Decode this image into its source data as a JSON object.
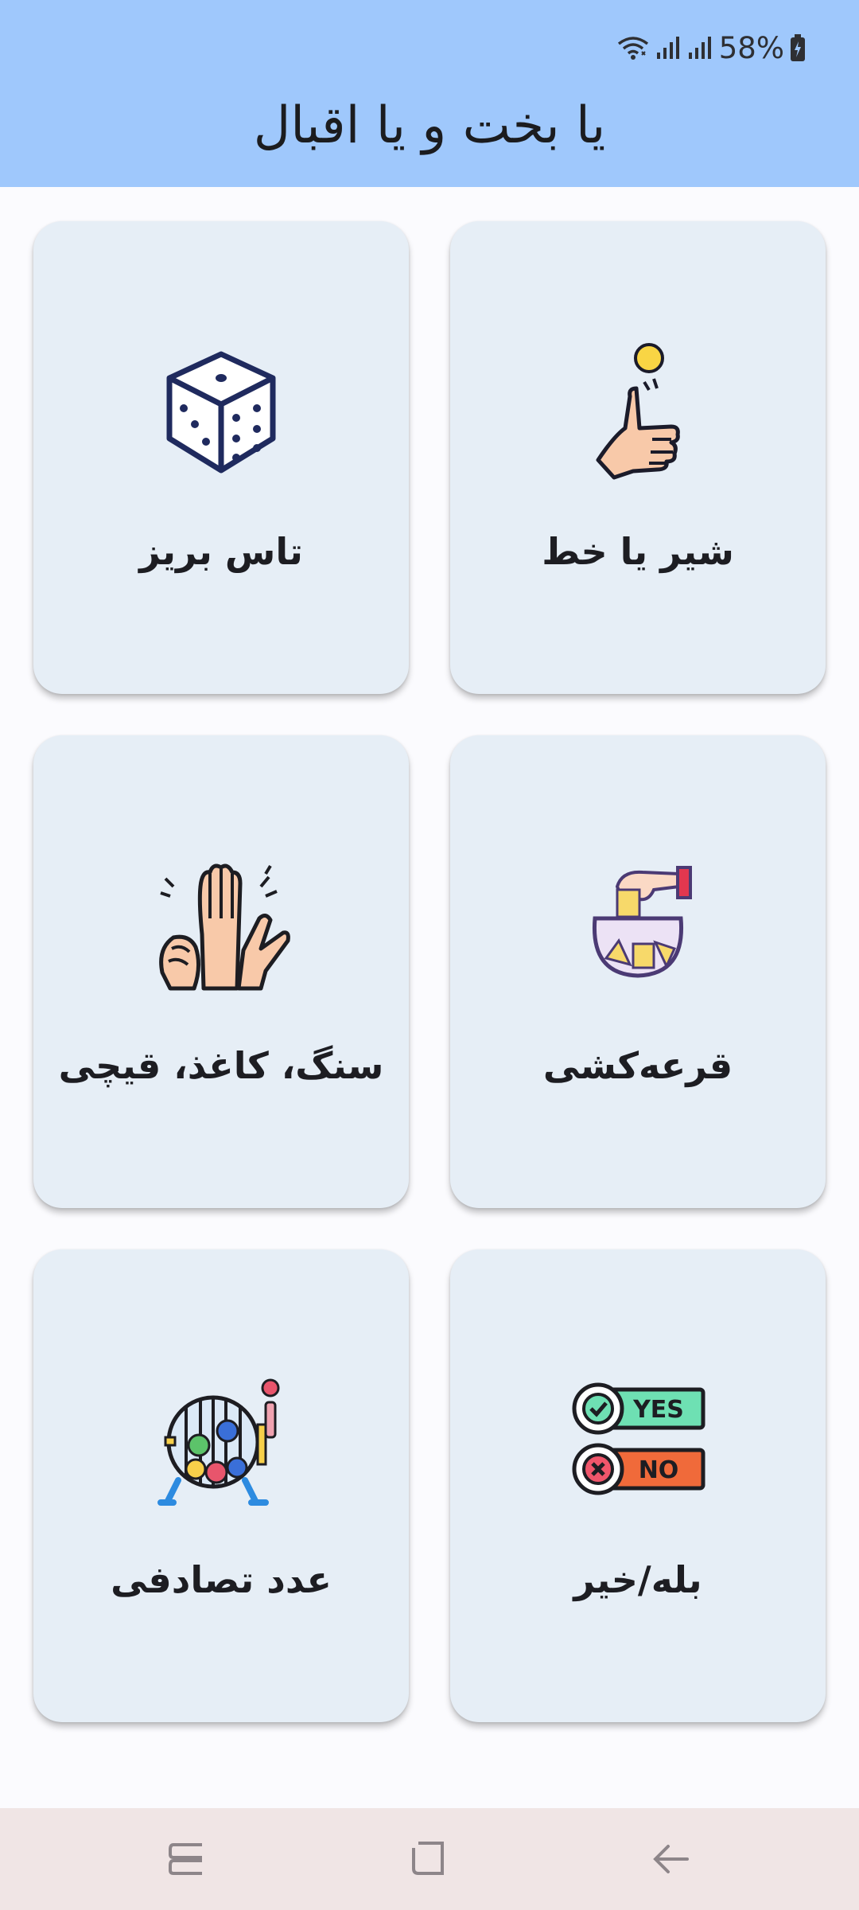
{
  "status_bar": {
    "battery_percent": "58%",
    "icons": [
      "wifi-icon",
      "signal-icon",
      "signal-icon",
      "battery-icon"
    ]
  },
  "app": {
    "title": "یا بخت و یا اقبال",
    "header_color": "#9fc8fc",
    "card_color": "#e6eef6"
  },
  "cards": [
    {
      "label": "شیر یا خط",
      "icon": "coin-flip-icon"
    },
    {
      "label": "تاس بریز",
      "icon": "dice-icon"
    },
    {
      "label": "قرعه‌کشی",
      "icon": "lottery-draw-icon"
    },
    {
      "label": "سنگ، کاغذ، قیچی",
      "icon": "rock-paper-scissors-icon"
    },
    {
      "label": "بله/خیر",
      "icon": "yes-no-icon"
    },
    {
      "label": "عدد تصادفی",
      "icon": "bingo-cage-icon"
    }
  ],
  "yes_no_icon_text": {
    "yes": "YES",
    "no": "NO"
  },
  "nav_bar": {
    "buttons": [
      "recents-icon",
      "home-icon",
      "back-icon"
    ]
  }
}
